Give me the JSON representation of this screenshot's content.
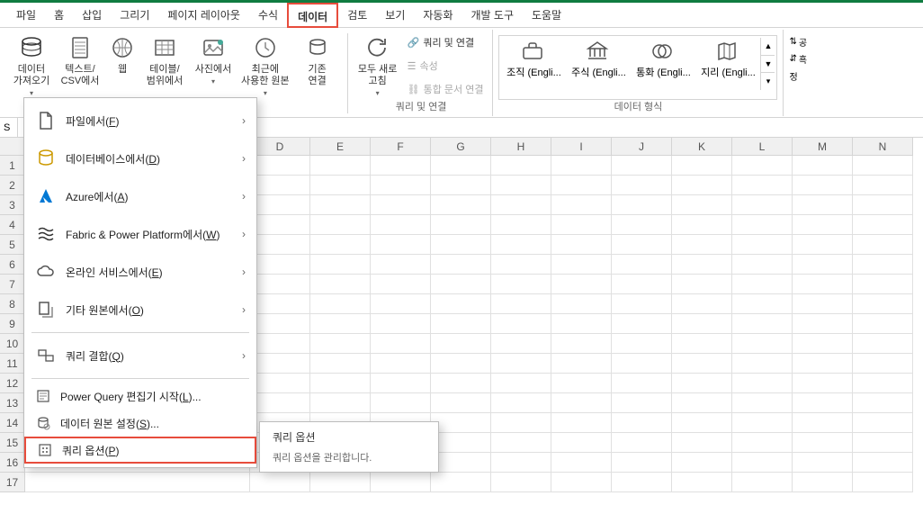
{
  "tabs": {
    "file": "파일",
    "home": "홈",
    "insert": "삽입",
    "draw": "그리기",
    "pagelayout": "페이지 레이아웃",
    "formulas": "수식",
    "data": "데이터",
    "review": "검토",
    "view": "보기",
    "automate": "자동화",
    "developer": "개발 도구",
    "help": "도움말"
  },
  "ribbon": {
    "get_data": "데이터\n가져오기",
    "from_csv": "텍스트/\nCSV에서",
    "from_web": "웹",
    "from_table": "테이블/\n범위에서",
    "from_image": "사진에서",
    "recent": "최근에\n사용한 원본",
    "existing_conn": "기존\n연결",
    "refresh_all": "모두 새로\n고침",
    "queries_conn": "쿼리 및 연결",
    "properties": "속성",
    "edit_links": "통합 문서 연결",
    "group_query_label": "쿼리 및 연결",
    "stocks": "조직 (Engli...",
    "currency": "주식 (Engli...",
    "currencies": "통화 (Engli...",
    "geography": "지리 (Engli...",
    "data_types_label": "데이터 형식",
    "sort1": "공",
    "sort2": "흑",
    "sort3": "정"
  },
  "menu": {
    "from_file": "파일에서",
    "from_file_key": "F",
    "from_db": "데이터베이스에서",
    "from_db_key": "D",
    "from_azure": "Azure에서",
    "from_azure_key": "A",
    "from_fabric": "Fabric & Power Platform에서",
    "from_fabric_key": "W",
    "from_online": "온라인 서비스에서",
    "from_online_key": "E",
    "from_other": "기타 원본에서",
    "from_other_key": "O",
    "combine": "쿼리 결합",
    "combine_key": "Q",
    "pq_editor": "Power Query 편집기 시작",
    "pq_editor_key": "L",
    "ds_settings": "데이터 원본 설정",
    "ds_settings_key": "S",
    "query_options": "쿼리 옵션",
    "query_options_key": "P"
  },
  "tooltip": {
    "title": "쿼리 옵션",
    "body": "쿼리 옵션을 관리합니다."
  },
  "columns": [
    "D",
    "E",
    "F",
    "G",
    "H",
    "I",
    "J",
    "K",
    "L",
    "M",
    "N"
  ],
  "rows": [
    "1",
    "2",
    "3",
    "4",
    "5",
    "6",
    "7",
    "8",
    "9",
    "10",
    "11",
    "12",
    "13",
    "14",
    "15",
    "16",
    "17"
  ],
  "namebox_hint": "S"
}
